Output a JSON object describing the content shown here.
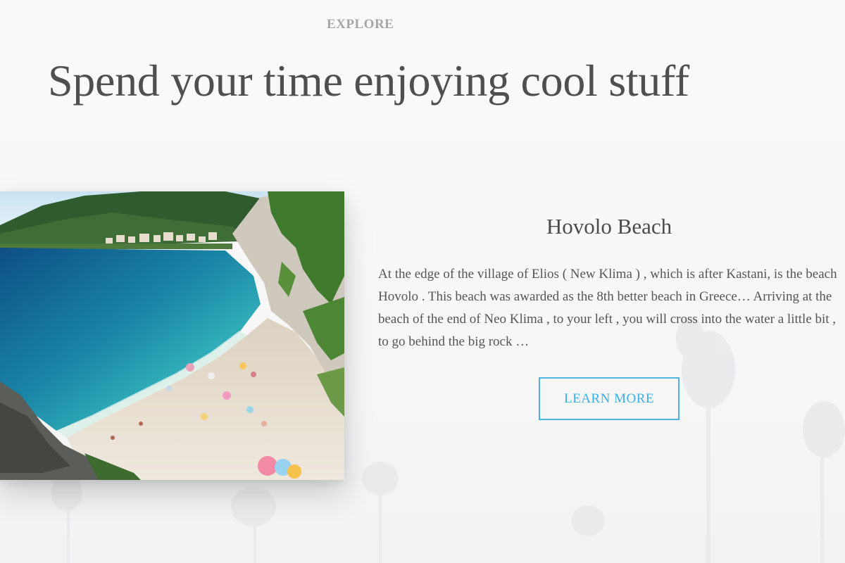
{
  "section": {
    "eyebrow": "EXPLORE",
    "headline": "Spend your time enjoying cool stuff"
  },
  "feature": {
    "image_alt": "Hovolo Beach photo",
    "title": "Hovolo Beach",
    "description": "At the edge of the village of Elios ( New Klima ) , which is after Kastani, is the beach Hovolo . This beach was awarded as the 8th better beach in Greece… Arriving at the beach of the end of Neo Klima , to your left , you will cross into the water a little bit , to go behind the big rock …",
    "cta_label": "LEARN MORE"
  },
  "colors": {
    "accent": "#3aaee6",
    "headline": "#4f4f4f",
    "eyebrow": "#a6a6a6",
    "background": "#f8f8f9"
  }
}
